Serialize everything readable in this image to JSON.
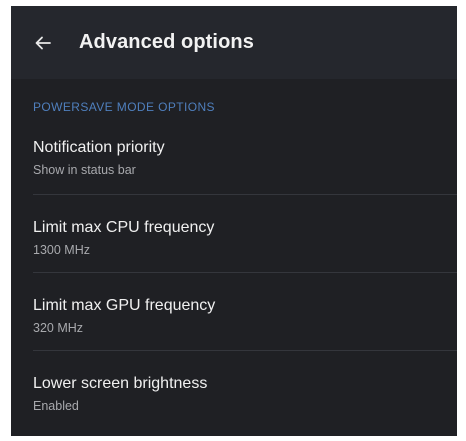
{
  "app_bar": {
    "title": "Advanced options",
    "back_icon": "arrow-left-icon"
  },
  "section": {
    "header": "POWERSAVE MODE OPTIONS"
  },
  "items": [
    {
      "title": "Notification priority",
      "subtitle": "Show in status bar"
    },
    {
      "title": "Limit max CPU frequency",
      "subtitle": "1300 MHz"
    },
    {
      "title": "Limit max GPU frequency",
      "subtitle": "320 MHz"
    },
    {
      "title": "Lower screen brightness",
      "subtitle": "Enabled"
    }
  ],
  "colors": {
    "background": "#1f2024",
    "app_bar": "#25272d",
    "section_header": "#4f7fbd",
    "primary_text": "#f0f0f0",
    "secondary_text": "#a8a9ad"
  }
}
